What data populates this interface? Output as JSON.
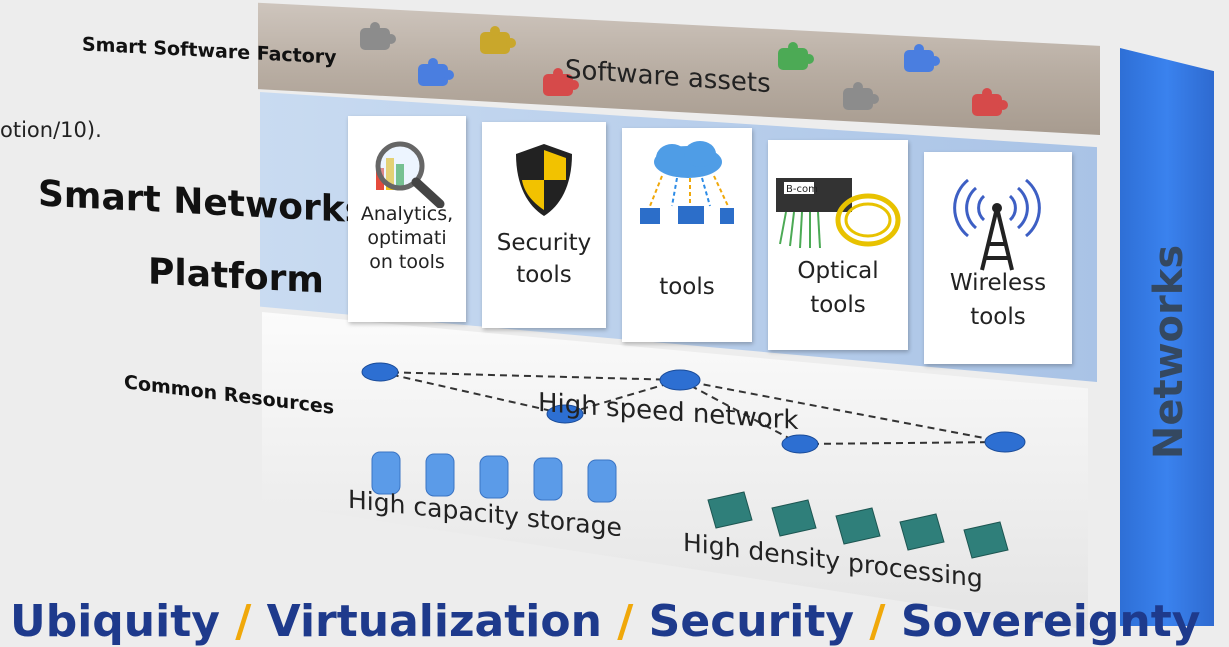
{
  "labels": {
    "smart_software_factory": "Smart Software Factory",
    "fragment": "otion/10).",
    "smart_networks_line1": "Smart Networks",
    "smart_networks_line2": "Platform",
    "common_resources": "Common Resources",
    "networks": "Networks"
  },
  "factory": {
    "assets_text": "Software assets",
    "puzzle_colors": [
      "#8c8c8c",
      "#4a7ee0",
      "#c9a72b",
      "#d64a4a",
      "#4caa55",
      "#4a7ee0",
      "#8c8c8c",
      "#d64a4a"
    ]
  },
  "tools": [
    {
      "icon": "analytics-magnifier-icon",
      "label_lines": [
        "Analytics,",
        "optimati",
        "on tools"
      ]
    },
    {
      "icon": "security-shield-icon",
      "label_lines": [
        "Security",
        "tools"
      ]
    },
    {
      "icon": "cloud-devices-icon",
      "label_lines": [
        "tools"
      ]
    },
    {
      "icon": "optical-fiber-icon",
      "device_text": "B-com",
      "label_lines": [
        "Optical",
        "tools"
      ]
    },
    {
      "icon": "wireless-antenna-icon",
      "label_lines": [
        "Wireless",
        "tools"
      ]
    }
  ],
  "resources": {
    "network_label": "High speed network",
    "storage_label": "High capacity storage",
    "processing_label": "High density processing"
  },
  "banner": {
    "words": [
      "Ubiquity",
      "Virtualization",
      "Security",
      "Sovereignty"
    ],
    "separator": "/"
  },
  "colors": {
    "network_bar": "#3a7de8",
    "banner_text": "#1e3a8c",
    "banner_separator": "#f0a80a",
    "platform_layer": "#b9cfee",
    "factory_layer": "#b8ada3"
  }
}
